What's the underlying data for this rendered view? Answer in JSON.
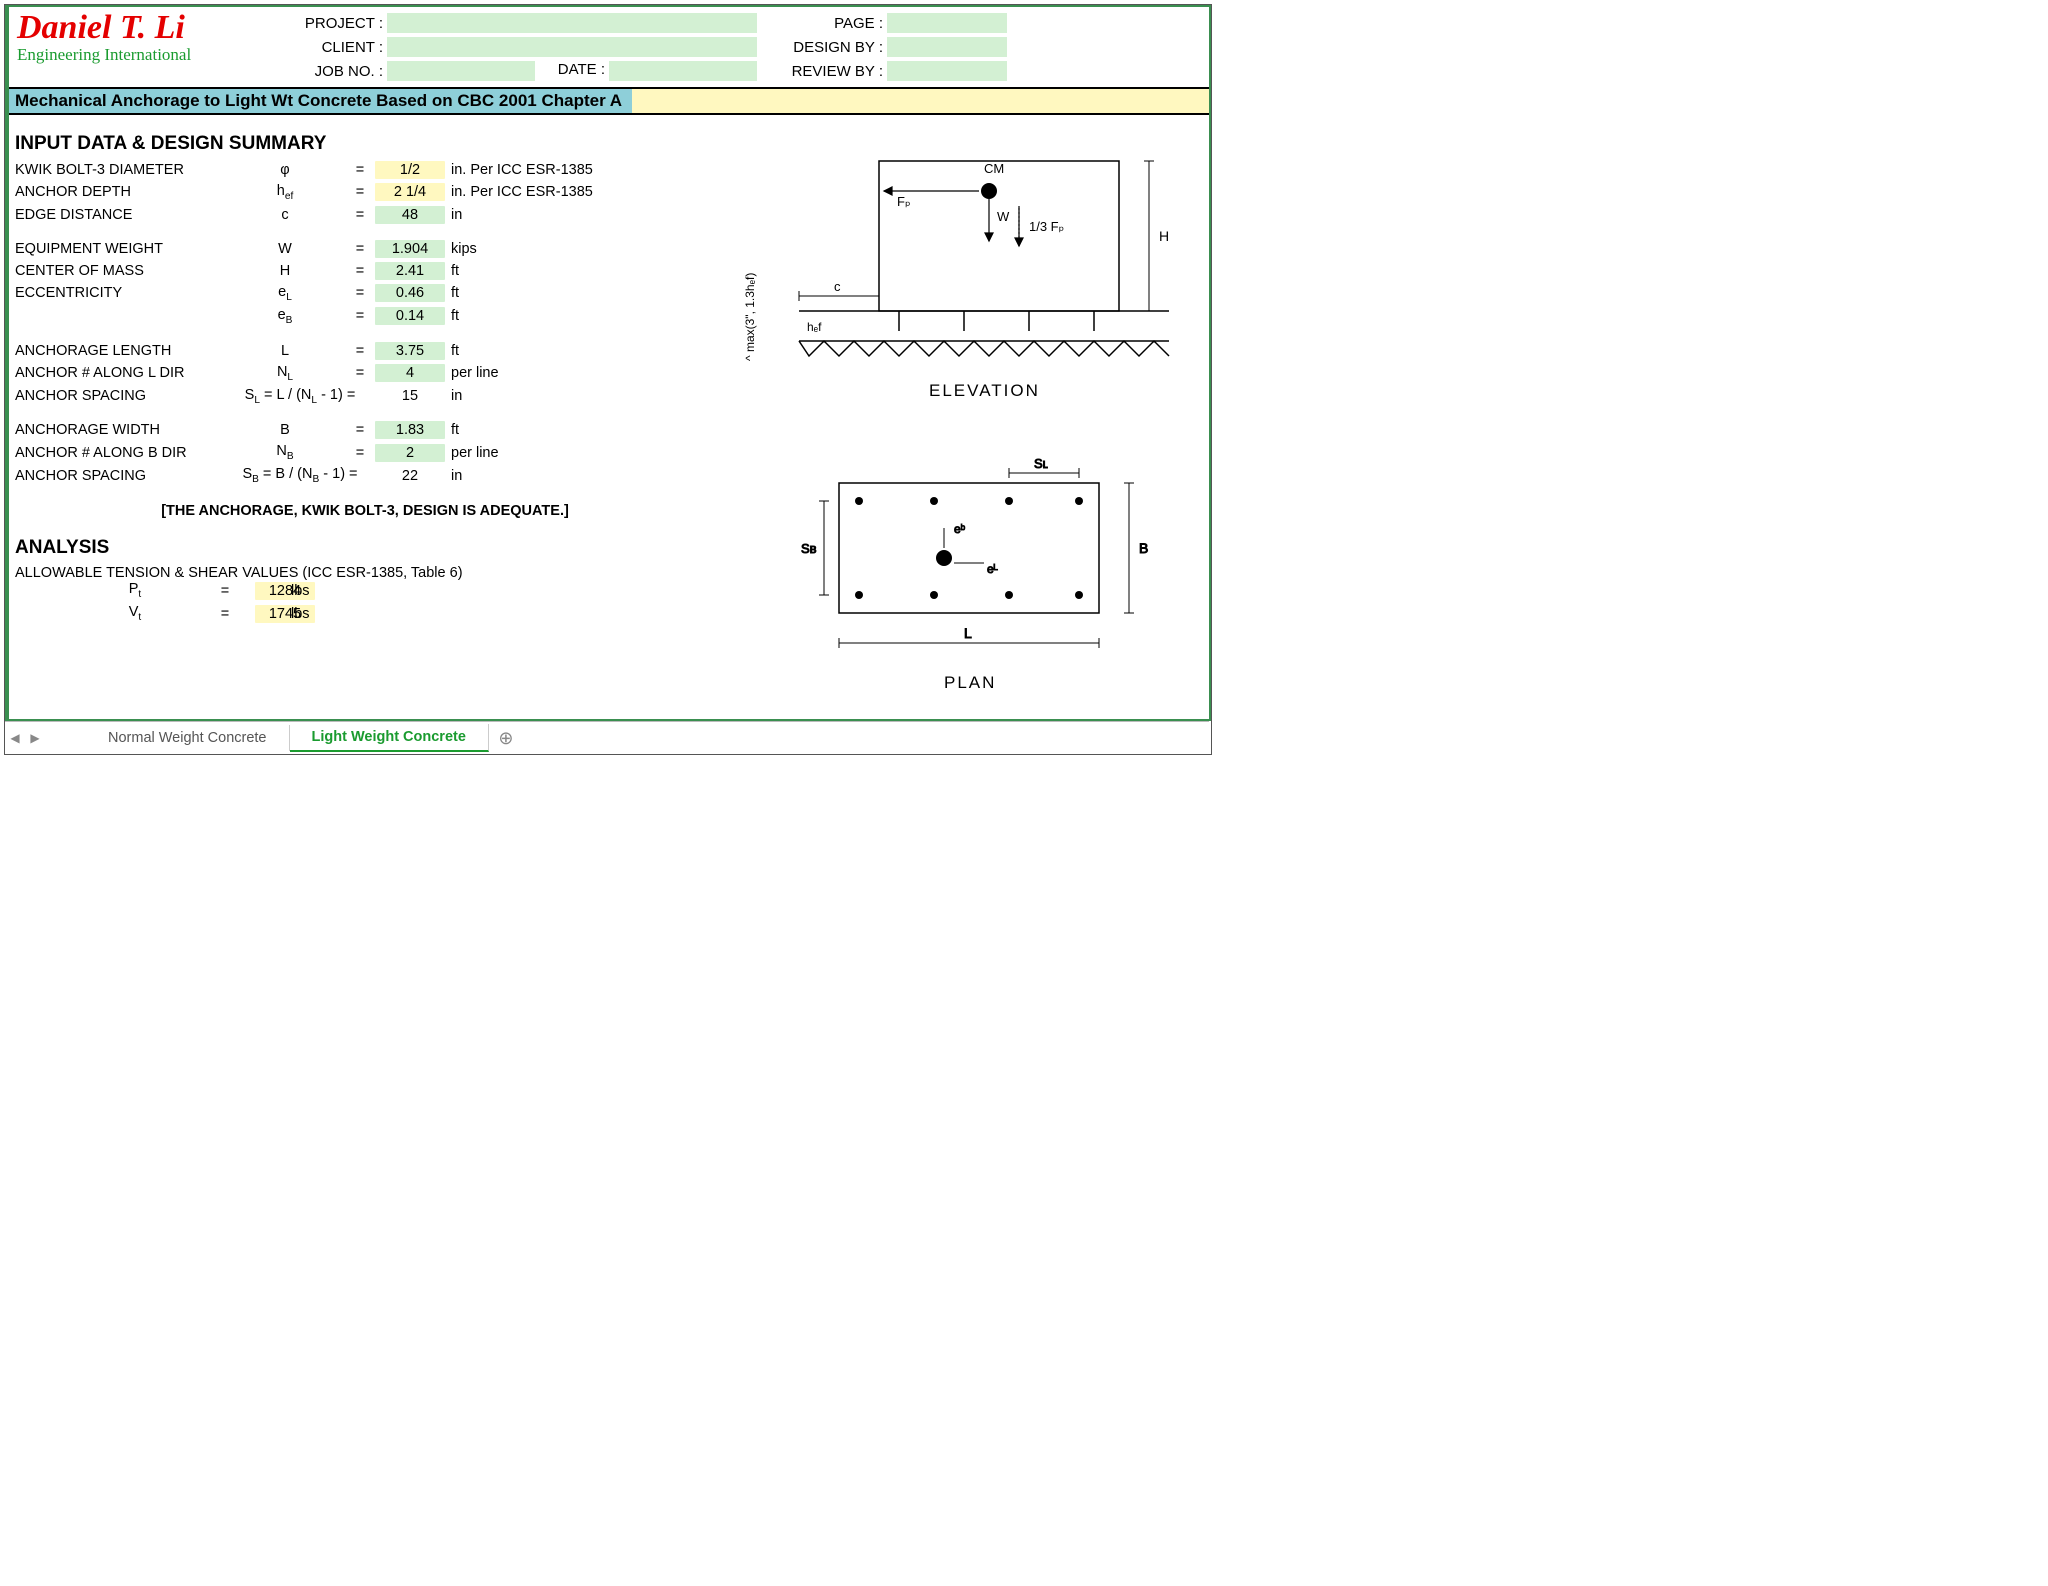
{
  "brand": {
    "name": "Daniel T. Li",
    "subtitle": "Engineering International"
  },
  "header": {
    "project_lbl": "PROJECT :",
    "client_lbl": "CLIENT :",
    "jobno_lbl": "JOB NO. :",
    "date_lbl": "DATE :",
    "page_lbl": "PAGE :",
    "design_lbl": "DESIGN BY :",
    "review_lbl": "REVIEW BY :"
  },
  "title": "Mechanical Anchorage to Light Wt Concrete Based on CBC 2001 Chapter A",
  "section1": "INPUT DATA & DESIGN SUMMARY",
  "rows": {
    "diam": {
      "lbl": "KWIK BOLT-3 DIAMETER",
      "sym": "φ",
      "val": "1/2",
      "unit": "in. Per ICC ESR-1385",
      "cls": "yellow"
    },
    "depth": {
      "lbl": "ANCHOR DEPTH",
      "sym": "hₑբ",
      "val": "2 1/4",
      "unit": "in. Per ICC ESR-1385",
      "cls": "yellow"
    },
    "edge": {
      "lbl": "EDGE DISTANCE",
      "sym": "c",
      "val": "48",
      "unit": "in",
      "cls": "green"
    },
    "weight": {
      "lbl": "EQUIPMENT WEIGHT",
      "sym": "W",
      "val": "1.904",
      "unit": "kips",
      "cls": "green"
    },
    "com": {
      "lbl": "CENTER OF MASS",
      "sym": "H",
      "val": "2.41",
      "unit": "ft",
      "cls": "green"
    },
    "ecc_l": {
      "lbl": "ECCENTRICITY",
      "sym": "e_L",
      "val": "0.46",
      "unit": "ft",
      "cls": "green"
    },
    "ecc_b": {
      "lbl": "",
      "sym": "e_B",
      "val": "0.14",
      "unit": "ft",
      "cls": "green"
    },
    "anc_l": {
      "lbl": "ANCHORAGE LENGTH",
      "sym": "L",
      "val": "3.75",
      "unit": "ft",
      "cls": "green"
    },
    "nl": {
      "lbl": "ANCHOR # ALONG L DIR",
      "sym": "N_L",
      "val": "4",
      "unit": "per line",
      "cls": "green"
    },
    "sl": {
      "lbl": "ANCHOR SPACING",
      "sym": "S_L = L / (N_L - 1) =",
      "val": "15",
      "unit": "in",
      "cls": ""
    },
    "anc_b": {
      "lbl": "ANCHORAGE WIDTH",
      "sym": "B",
      "val": "1.83",
      "unit": "ft",
      "cls": "green"
    },
    "nb": {
      "lbl": "ANCHOR # ALONG B DIR",
      "sym": "N_B",
      "val": "2",
      "unit": "per line",
      "cls": "green"
    },
    "sb": {
      "lbl": "ANCHOR SPACING",
      "sym": "S_B = B / (N_B - 1) =",
      "val": "22",
      "unit": "in",
      "cls": ""
    }
  },
  "note": "[THE ANCHORAGE, KWIK BOLT-3,  DESIGN IS ADEQUATE.]",
  "section2": "ANALYSIS",
  "analysis_sub": "ALLOWABLE TENSION & SHEAR VALUES (ICC ESR-1385, Table 6)",
  "an": {
    "pt": {
      "sym": "Pₜ",
      "val": "1284",
      "unit": "lbs"
    },
    "vt": {
      "sym": "Vₜ",
      "val": "1745",
      "unit": "lbs"
    }
  },
  "diagram": {
    "elev": "ELEVATION",
    "plan": "PLAN",
    "cm": "CM",
    "fp": "Fₚ",
    "w": "W",
    "fp3": "1/3 Fₚ",
    "H": "H",
    "c": "c",
    "hef": "hₑբ",
    "max": "^ max(3\", 1.3hₑբ)",
    "SL": "Sʟ",
    "SB": "Sʙ",
    "eB": "eᵇ",
    "eL": "eᴸ",
    "L": "L",
    "B": "B"
  },
  "tabs": {
    "t1": "Normal Weight Concrete",
    "t2": "Light Weight Concrete"
  }
}
